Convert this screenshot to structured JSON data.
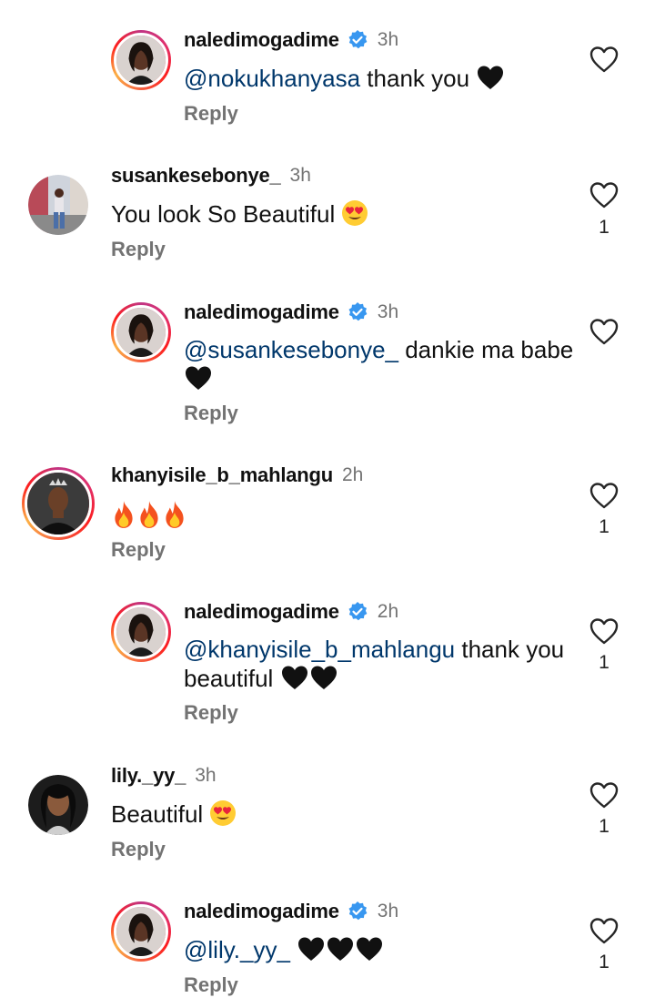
{
  "comments": [
    {
      "user": "naledimogadime",
      "verified": true,
      "time": "3h",
      "mention": "@nokukhanyasa",
      "text": " thank you",
      "emojis": "black-heart-x1",
      "reply": "Reply",
      "likes": ""
    },
    {
      "user": "susankesebonye_",
      "verified": false,
      "time": "3h",
      "mention": "",
      "text": "You look So Beautiful",
      "emojis": "heart-eyes-x1",
      "reply": "Reply",
      "likes": "1"
    },
    {
      "user": "naledimogadime",
      "verified": true,
      "time": "3h",
      "mention": "@susankesebonye_",
      "text": " dankie ma babe",
      "emojis": "black-heart-x1",
      "reply": "Reply",
      "likes": ""
    },
    {
      "user": "khanyisile_b_mahlangu",
      "verified": false,
      "time": "2h",
      "mention": "",
      "text": "",
      "emojis": "fire-x3",
      "reply": "Reply",
      "likes": "1"
    },
    {
      "user": "naledimogadime",
      "verified": true,
      "time": "2h",
      "mention": "@khanyisile_b_mahlangu",
      "text": " thank you",
      "text2": "beautiful",
      "emojis": "black-heart-x2",
      "reply": "Reply",
      "likes": "1"
    },
    {
      "user": "lily._yy_",
      "verified": false,
      "time": "3h",
      "mention": "",
      "text": "Beautiful",
      "emojis": "heart-eyes-x1",
      "reply": "Reply",
      "likes": "1"
    },
    {
      "user": "naledimogadime",
      "verified": true,
      "time": "3h",
      "mention": "@lily._yy_",
      "text": "",
      "emojis": "black-heart-x3",
      "reply": "Reply",
      "likes": "1"
    }
  ],
  "colors": {
    "mention": "#00376b",
    "meta": "#737373",
    "verified": "#3897f0"
  }
}
